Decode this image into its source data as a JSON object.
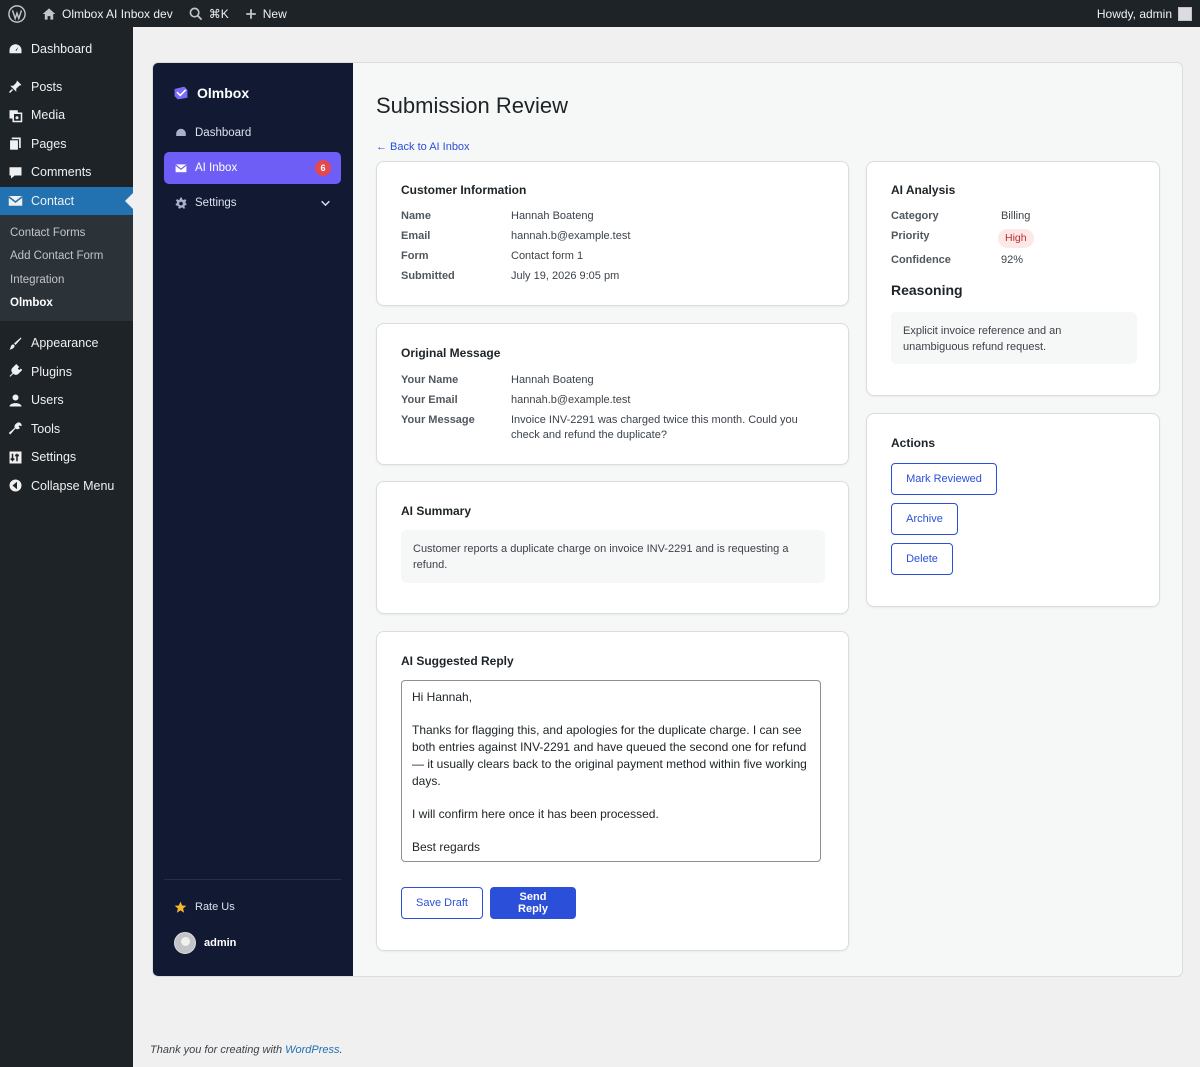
{
  "adminbar": {
    "site_name": "Olmbox AI Inbox dev",
    "search_shortcut": "⌘K",
    "new_label": "New",
    "greeting": "Howdy, admin"
  },
  "wpmenu": {
    "dashboard": "Dashboard",
    "posts": "Posts",
    "media": "Media",
    "pages": "Pages",
    "comments": "Comments",
    "contact": "Contact",
    "contact_sub": [
      "Contact Forms",
      "Add Contact Form",
      "Integration",
      "Olmbox"
    ],
    "appearance": "Appearance",
    "plugins": "Plugins",
    "users": "Users",
    "tools": "Tools",
    "settings": "Settings",
    "collapse": "Collapse Menu"
  },
  "plugin_nav": {
    "brand": "Olmbox",
    "dashboard": "Dashboard",
    "ai_inbox": "AI Inbox",
    "ai_inbox_badge": "6",
    "settings": "Settings",
    "rate_us": "Rate Us",
    "user": "admin"
  },
  "page": {
    "title": "Submission Review",
    "back_link": "← Back to AI Inbox"
  },
  "customer_info": {
    "heading": "Customer Information",
    "rows": [
      {
        "k": "Name",
        "v": "Hannah Boateng"
      },
      {
        "k": "Email",
        "v": "hannah.b@example.test"
      },
      {
        "k": "Form",
        "v": "Contact form 1"
      },
      {
        "k": "Submitted",
        "v": "July 19, 2026 9:05 pm"
      }
    ]
  },
  "original_message": {
    "heading": "Original Message",
    "rows": [
      {
        "k": "Your Name",
        "v": "Hannah Boateng"
      },
      {
        "k": "Your Email",
        "v": "hannah.b@example.test"
      },
      {
        "k": "Your Message",
        "v": "Invoice INV-2291 was charged twice this month. Could you check and refund the duplicate?"
      }
    ]
  },
  "ai_summary": {
    "heading": "AI Summary",
    "text": "Customer reports a duplicate charge on invoice INV-2291 and is requesting a refund."
  },
  "ai_reply": {
    "heading": "AI Suggested Reply",
    "text": "Hi Hannah,\n\nThanks for flagging this, and apologies for the duplicate charge. I can see both entries against INV-2291 and have queued the second one for refund — it usually clears back to the original payment method within five working days.\n\nI will confirm here once it has been processed.\n\nBest regards",
    "save_draft": "Save Draft",
    "send_reply": "Send Reply"
  },
  "ai_analysis": {
    "heading": "AI Analysis",
    "category_label": "Category",
    "category": "Billing",
    "priority_label": "Priority",
    "priority": "High",
    "confidence_label": "Confidence",
    "confidence": "92%",
    "reasoning_heading": "Reasoning",
    "reasoning": "Explicit invoice reference and an unambiguous refund request."
  },
  "actions": {
    "heading": "Actions",
    "mark_reviewed": "Mark Reviewed",
    "archive": "Archive",
    "delete": "Delete"
  },
  "footer": {
    "text": "Thank you for creating with ",
    "link": "WordPress",
    "suffix": "."
  },
  "colors": {
    "accent": "#2b4fd8",
    "sidebar_bg": "#121933",
    "active_nav": "#6f5ef5",
    "wp_active": "#2271b1",
    "priority_high": "#c02b2b"
  }
}
